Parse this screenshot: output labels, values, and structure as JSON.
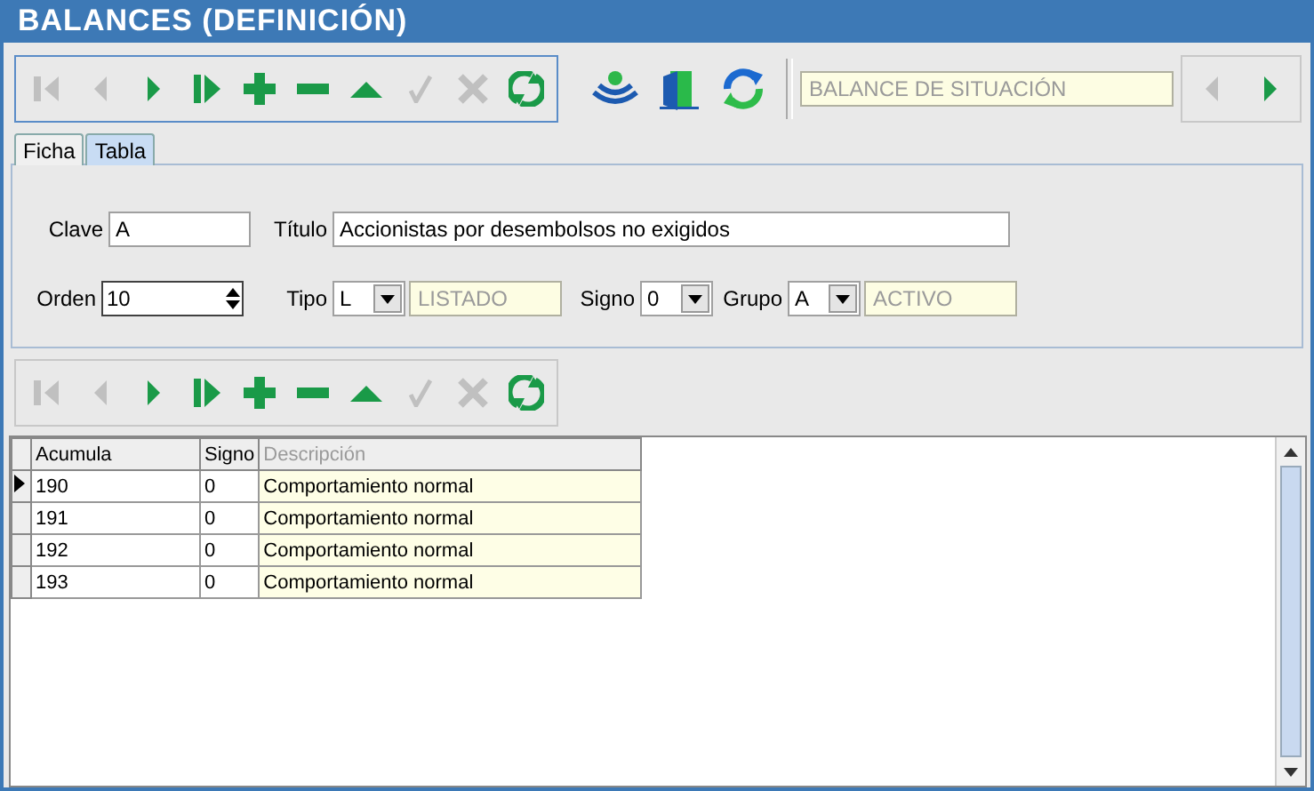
{
  "window": {
    "title": "BALANCES (DEFINICIÓN)"
  },
  "toolbar": [
    {
      "kind": "first",
      "enabled": false
    },
    {
      "kind": "prior",
      "enabled": false
    },
    {
      "kind": "next",
      "enabled": true
    },
    {
      "kind": "last",
      "enabled": true
    },
    {
      "kind": "insert",
      "enabled": true
    },
    {
      "kind": "delete",
      "enabled": true
    },
    {
      "kind": "edit",
      "enabled": true
    },
    {
      "kind": "post",
      "enabled": false
    },
    {
      "kind": "cancel",
      "enabled": false
    },
    {
      "kind": "refresh",
      "enabled": true
    }
  ],
  "extra_tools": [
    {
      "kind": "signal"
    },
    {
      "kind": "door"
    },
    {
      "kind": "sync"
    }
  ],
  "balance_field": {
    "value": "BALANCE DE SITUACIÓN"
  },
  "balance_nav": [
    {
      "kind": "prior",
      "enabled": false
    },
    {
      "kind": "next",
      "enabled": true
    }
  ],
  "tabs": [
    {
      "label": "Ficha",
      "selected": true
    },
    {
      "label": "Tabla",
      "selected": false
    }
  ],
  "form": {
    "clave": {
      "label": "Clave",
      "value": "A"
    },
    "orden": {
      "label": "Orden",
      "value": "10"
    },
    "titulo": {
      "label": "Título",
      "value": "Accionistas por desembolsos no exigidos"
    },
    "tipo": {
      "label": "Tipo",
      "value": "L",
      "description": "LISTADO"
    },
    "signo": {
      "label": "Signo",
      "value": "0"
    },
    "grupo": {
      "label": "Grupo",
      "value": "A",
      "description": "ACTIVO"
    }
  },
  "detail_toolbar": [
    {
      "kind": "first",
      "enabled": false
    },
    {
      "kind": "prior",
      "enabled": false
    },
    {
      "kind": "next",
      "enabled": true
    },
    {
      "kind": "last",
      "enabled": true
    },
    {
      "kind": "insert",
      "enabled": true
    },
    {
      "kind": "delete",
      "enabled": true
    },
    {
      "kind": "edit",
      "enabled": true
    },
    {
      "kind": "post",
      "enabled": false
    },
    {
      "kind": "cancel",
      "enabled": false
    },
    {
      "kind": "refresh",
      "enabled": true
    }
  ],
  "table": {
    "columns": [
      {
        "label": "Acumula",
        "readonly": false
      },
      {
        "label": "Signo",
        "readonly": false
      },
      {
        "label": "Descripción",
        "readonly": true
      }
    ],
    "rows": [
      {
        "cells": [
          "190",
          "0",
          "Comportamiento normal"
        ],
        "selected": true
      },
      {
        "cells": [
          "191",
          "0",
          "Comportamiento normal"
        ],
        "selected": false
      },
      {
        "cells": [
          "192",
          "0",
          "Comportamiento normal"
        ],
        "selected": false
      },
      {
        "cells": [
          "193",
          "0",
          "Comportamiento normal"
        ],
        "selected": false
      }
    ]
  }
}
